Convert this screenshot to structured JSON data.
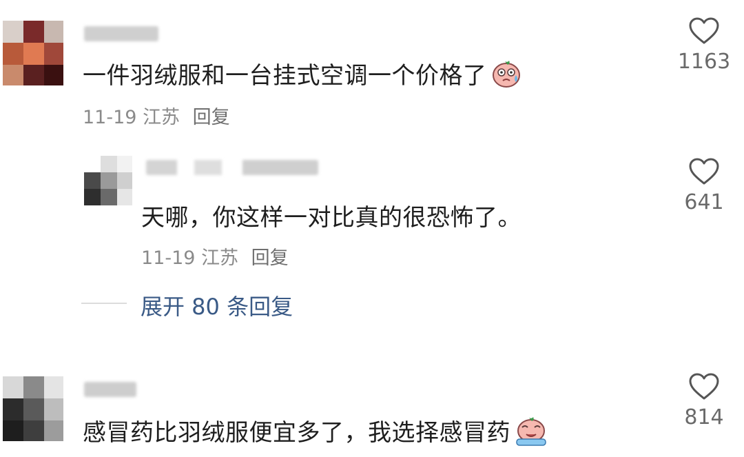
{
  "comments": [
    {
      "text": "一件羽绒服和一台挂式空调一个价格了",
      "emoji": "crying-face-emoji",
      "date": "11-19",
      "location": "江苏",
      "reply_label": "回复",
      "likes": "1163"
    },
    {
      "text": "天哪，你这样一对比真的很恐怖了。",
      "date": "11-19",
      "location": "江苏",
      "reply_label": "回复",
      "likes": "641"
    },
    {
      "text": "感冒药比羽绒服便宜多了，我选择感冒药",
      "emoji": "sobbing-face-emoji",
      "likes": "814"
    }
  ],
  "expand_replies": "展开 80 条回复",
  "colors": {
    "text": "#1e1e1e",
    "meta": "#8a8a8a",
    "link": "#3a5a86",
    "icon": "#555555"
  }
}
